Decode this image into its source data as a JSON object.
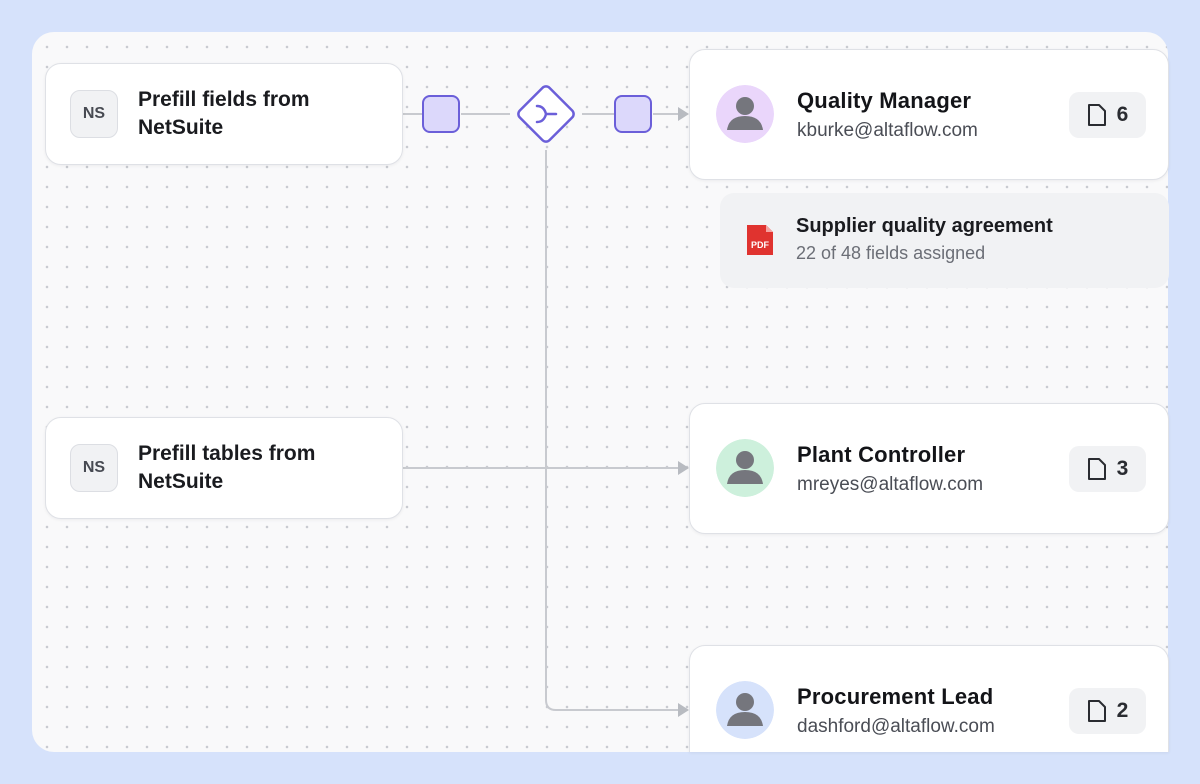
{
  "sources": [
    {
      "badge": "NS",
      "label": "Prefill fields from NetSuite"
    },
    {
      "badge": "NS",
      "label": "Prefill tables from NetSuite"
    }
  ],
  "recipients": [
    {
      "name": "Quality Manager",
      "email": "kburke@altaflow.com",
      "doc_count": "6",
      "avatar_color": "#ead6fb"
    },
    {
      "name": "Plant Controller",
      "email": "mreyes@altaflow.com",
      "doc_count": "3",
      "avatar_color": "#cdf0dc"
    },
    {
      "name": "Procurement Lead",
      "email": "dashford@altaflow.com",
      "doc_count": "2",
      "avatar_color": "#d6e2fb"
    }
  ],
  "document": {
    "icon_label": "PDF",
    "title": "Supplier quality agreement",
    "subtitle": "22 of 48 fields assigned"
  },
  "colors": {
    "accent": "#6b5fd9",
    "accent_fill": "#dcd8fb",
    "wire": "#c8cacf",
    "pdf_red": "#e0332f"
  }
}
